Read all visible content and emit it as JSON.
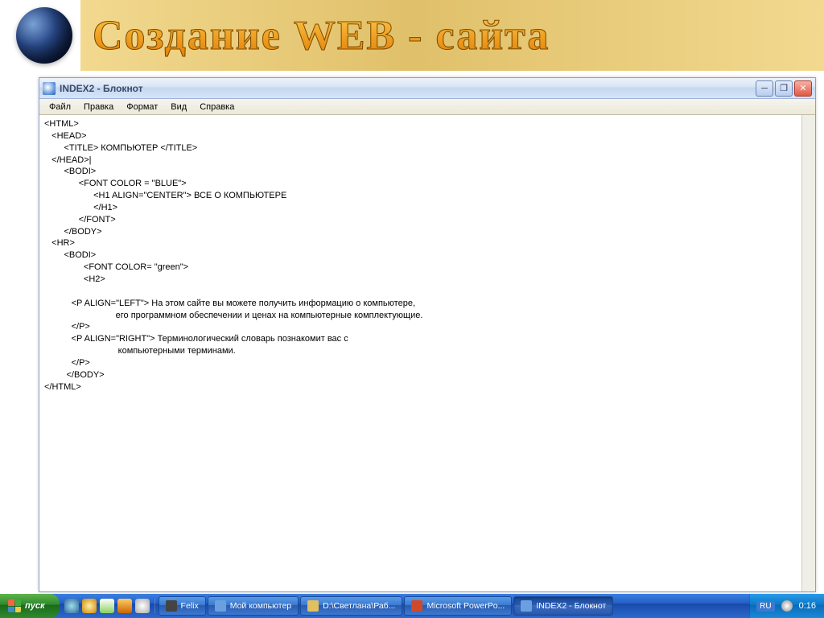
{
  "banner": {
    "title": "Создание WEB - сайта"
  },
  "window": {
    "title": "INDEX2 - Блокнот",
    "menu": [
      "Файл",
      "Правка",
      "Формат",
      "Вид",
      "Справка"
    ]
  },
  "notepad_content": "<HTML>\n   <HEAD>\n        <TITLE> КОМПЬЮТЕР </TITLE>\n   </HEAD>|\n        <BODI>\n              <FONT COLOR = \"BLUE\">\n                    <H1 ALIGN=\"CENTER\"> ВСЕ О КОМПЬЮТЕРЕ\n                    </H1>\n              </FONT>\n        </BODY>\n   <HR>\n        <BODI>\n                <FONT COLOR= \"green\">\n                <H2>\n\n           <P ALIGN=\"LEFT\"> На этом сайте вы можете получить информацию о компьютере,\n                             его программном обеспечении и ценах на компьютерные комплектующие.\n           </P>\n           <P ALIGN=\"RIGHT\"> Терминологический словарь познакомит вас с\n                              компьютерными терминами.\n           </P>\n         </BODY>\n</HTML>",
  "taskbar": {
    "start": "пуск",
    "items": [
      {
        "label": "Felix",
        "icon_color": "#444"
      },
      {
        "label": "Мой компьютер",
        "icon_color": "#6aa0e0"
      },
      {
        "label": "D:\\Светлана\\Раб...",
        "icon_color": "#e0c060"
      },
      {
        "label": "Microsoft PowerPo...",
        "icon_color": "#d04a2a"
      },
      {
        "label": "INDEX2 - Блокнот",
        "icon_color": "#6aa0e0",
        "active": true
      }
    ],
    "lang": "RU",
    "clock": "0:16"
  }
}
